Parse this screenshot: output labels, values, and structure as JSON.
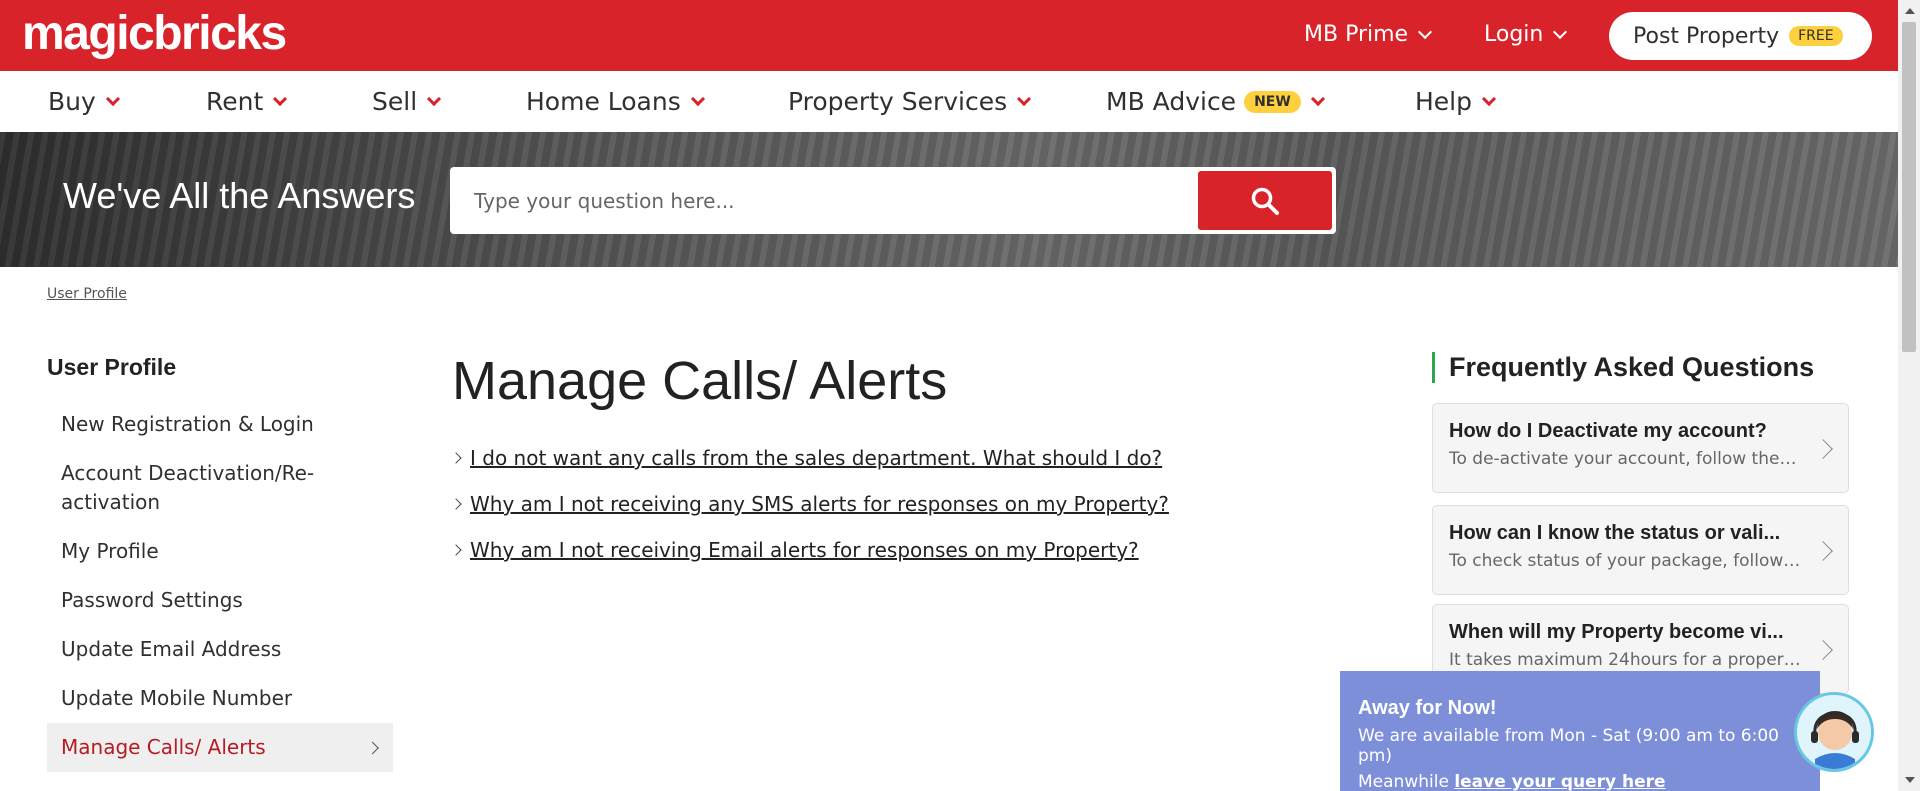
{
  "header": {
    "logo": "magicbricks",
    "mb_prime": "MB Prime",
    "login": "Login",
    "post_property": "Post Property",
    "free_badge": "FREE"
  },
  "nav": {
    "buy": "Buy",
    "rent": "Rent",
    "sell": "Sell",
    "home_loans": "Home Loans",
    "property_services": "Property Services",
    "mb_advice": "MB Advice",
    "new_badge": "NEW",
    "help": "Help"
  },
  "hero": {
    "title": "We've All the Answers",
    "search_placeholder": "Type your question here..."
  },
  "breadcrumb": "User Profile",
  "sidebar": {
    "title": "User Profile",
    "items": [
      {
        "label": "New Registration & Login"
      },
      {
        "label": "Account Deactivation/Re-activation"
      },
      {
        "label": "My Profile"
      },
      {
        "label": "Password Settings"
      },
      {
        "label": "Update Email Address"
      },
      {
        "label": "Update Mobile Number"
      },
      {
        "label": "Manage Calls/ Alerts"
      }
    ]
  },
  "main": {
    "title": "Manage Calls/ Alerts",
    "questions": [
      "I do not want any calls from the sales department. What should I do?",
      "Why am I not receiving any SMS alerts for responses on my Property?",
      "Why am I not receiving Email alerts for responses on my Property?"
    ]
  },
  "faq": {
    "title": "Frequently Asked Questions",
    "cards": [
      {
        "q": "How do I Deactivate my account?",
        "a": "To de-activate your account, follow these..."
      },
      {
        "q": "How can I know the status or vali...",
        "a": "To check status of your package, follow b..."
      },
      {
        "q": "When will my Property become vi...",
        "a": "It takes maximum 24hours for a property..."
      }
    ]
  },
  "chat": {
    "title": "Away for Now!",
    "availability": "We are available from Mon - Sat (9:00 am to 6:00 pm)",
    "meanwhile": "Meanwhile",
    "link": "leave your query here"
  },
  "colors": {
    "brand_red": "#d8232a",
    "faq_accent": "#2aa84a",
    "badge_yellow": "#ffd03e",
    "chat_bg": "#7e8fd9"
  }
}
